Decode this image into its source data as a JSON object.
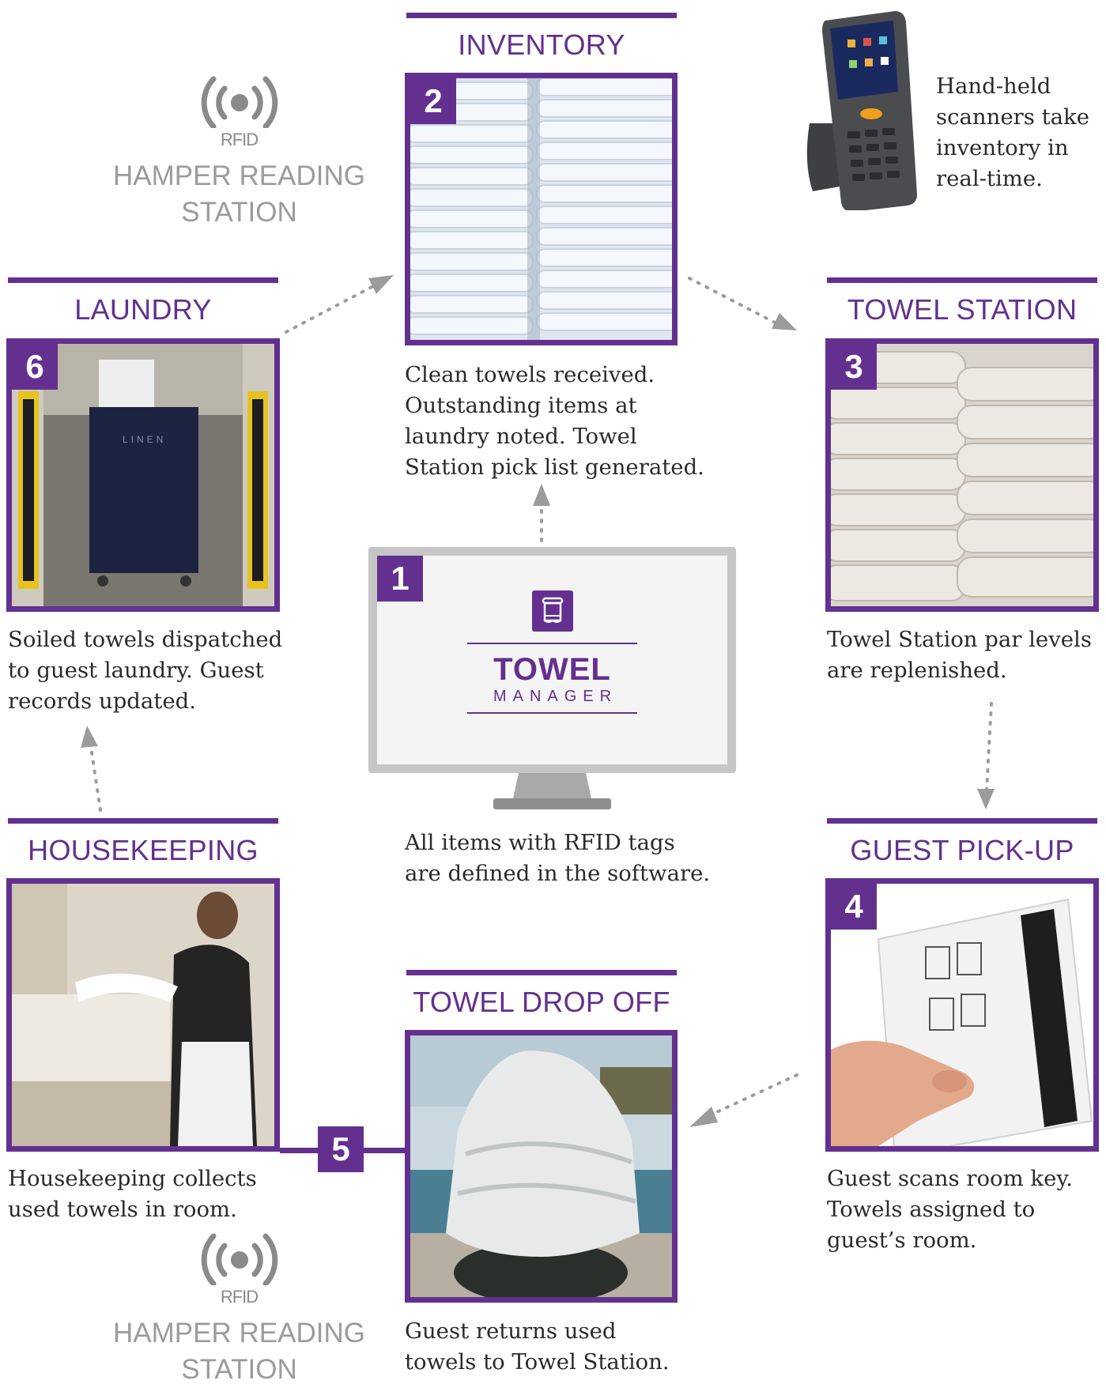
{
  "colors": {
    "accent": "#63308f",
    "text": "#2a2a2a",
    "muted": "#9b9b9b",
    "arrow": "#9b9b9b"
  },
  "rfid": {
    "label": "RFID",
    "hamper_line1": "HAMPER READING",
    "hamper_line2": "STATION"
  },
  "scanner": {
    "caption": [
      "Hand-held",
      "scanners take",
      "inventory in",
      "real-time."
    ]
  },
  "monitor": {
    "number": "1",
    "logo_top": "TOWEL",
    "logo_bottom": "MANAGER",
    "caption": [
      "All items with RFID tags",
      "are defined in the software."
    ]
  },
  "steps": {
    "inventory": {
      "title": "INVENTORY",
      "number": "2",
      "caption": [
        "Clean towels received.",
        "Outstanding items at",
        "laundry noted. Towel",
        "Station pick list generated."
      ]
    },
    "towel_station": {
      "title": "TOWEL STATION",
      "number": "3",
      "caption": [
        "Towel Station par levels",
        "are replenished."
      ]
    },
    "guest_pickup": {
      "title": "GUEST PICK-UP",
      "number": "4",
      "caption": [
        "Guest scans room key.",
        "Towels assigned to",
        "guest’s room."
      ]
    },
    "towel_drop_off": {
      "title": "TOWEL DROP OFF",
      "caption": [
        "Guest returns used",
        "towels to Towel Station."
      ]
    },
    "housekeeping": {
      "title": "HOUSEKEEPING",
      "number": "5",
      "caption": [
        "Housekeeping collects",
        "used towels in room."
      ]
    },
    "laundry": {
      "title": "LAUNDRY",
      "number": "6",
      "caption": [
        "Soiled towels dispatched",
        "to guest laundry. Guest",
        "records updated."
      ]
    }
  }
}
